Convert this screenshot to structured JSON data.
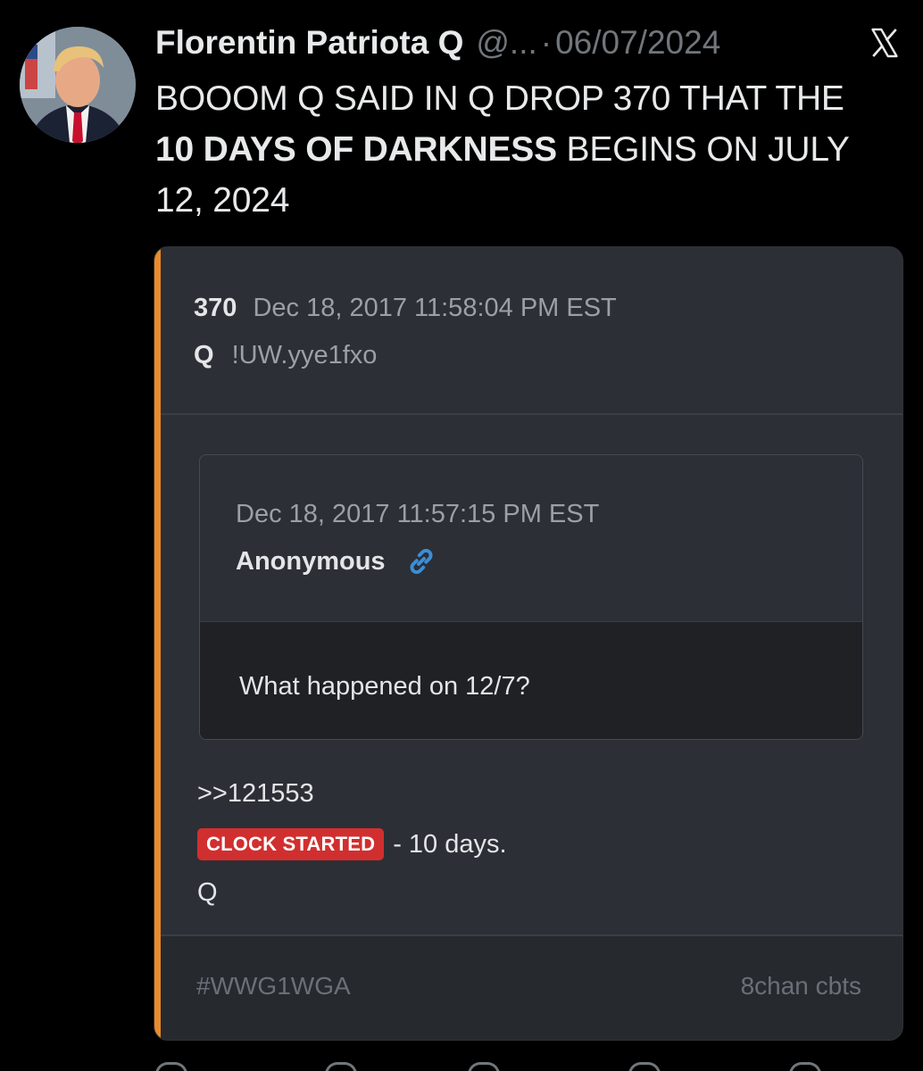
{
  "author": {
    "name": "Florentin Patriota Q",
    "handle": "@...",
    "separator": "·",
    "date": "06/07/2024",
    "avatar_icon": "profile-photo"
  },
  "platform_icon": "x-logo-icon",
  "tweet": {
    "text_part1": "BOOOM Q SAID IN Q DROP 370 THAT THE ",
    "text_bold": "10 DAYS OF DARKNESS",
    "text_part2": " BEGINS ON JULY 12, 2024"
  },
  "drop": {
    "number": "370",
    "timestamp": "Dec 18, 2017 11:58:04 PM EST",
    "author": "Q",
    "tripcode": "!UW.yye1fxo",
    "accent_color": "#e98a2c",
    "quote": {
      "timestamp": "Dec 18, 2017 11:57:15 PM EST",
      "author": "Anonymous",
      "link_icon": "link-icon",
      "text": "What happened on 12/7?"
    },
    "reference": ">>121553",
    "badge": "CLOCK STARTED",
    "badge_color": "#d12f2f",
    "after_badge": "- 10 days.",
    "signature": "Q",
    "hashtag": "#WWG1WGA",
    "source": "8chan cbts"
  }
}
